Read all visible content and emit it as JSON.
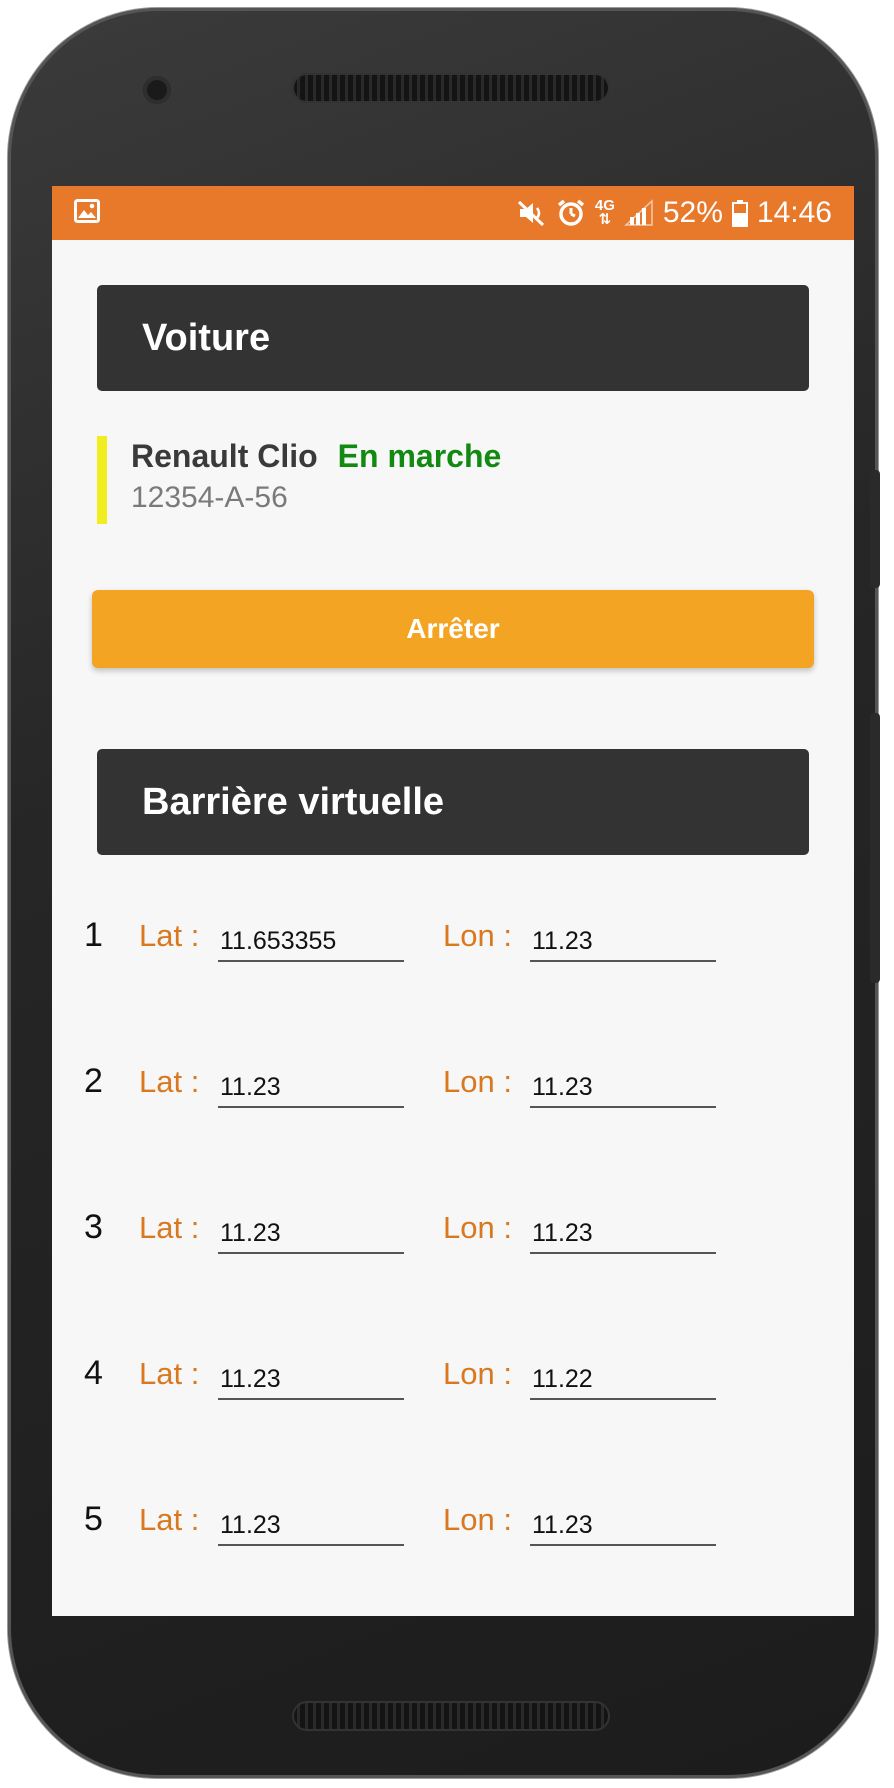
{
  "status_bar": {
    "battery": "52%",
    "time": "14:46",
    "network": "4G",
    "background_color": "#e8782a",
    "icons": [
      "gallery-icon",
      "mute-icon",
      "alarm-icon",
      "network-4g-icon",
      "signal-icon",
      "battery-icon"
    ]
  },
  "vehicle_section": {
    "title": "Voiture",
    "car_name": "Renault Clio",
    "car_status": "En marche",
    "car_plate": "12354-A-56",
    "status_color": "#128a12",
    "accent_color": "#f0ee1e"
  },
  "stop_button": {
    "label": "Arrêter",
    "color": "#f4a423"
  },
  "fence_section": {
    "title": "Barrière virtuelle",
    "lat_label": "Lat :",
    "lon_label": "Lon :",
    "points": [
      {
        "num": "1",
        "lat": "11.653355",
        "lon": "11.23"
      },
      {
        "num": "2",
        "lat": "11.23",
        "lon": "11.23"
      },
      {
        "num": "3",
        "lat": "11.23",
        "lon": "11.23"
      },
      {
        "num": "4",
        "lat": "11.23",
        "lon": "11.22"
      },
      {
        "num": "5",
        "lat": "11.23",
        "lon": "11.23"
      }
    ]
  }
}
